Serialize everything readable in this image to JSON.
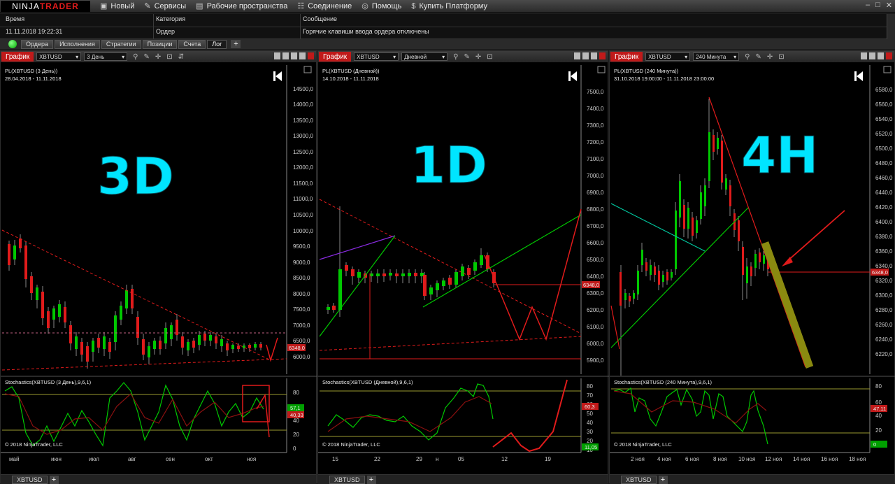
{
  "app": {
    "logo_left": "NINJA",
    "logo_right": "TRADER"
  },
  "menu": [
    {
      "icon": "new-icon",
      "label": "Новый"
    },
    {
      "icon": "services-icon",
      "label": "Сервисы"
    },
    {
      "icon": "workspace-icon",
      "label": "Рабочие пространства"
    },
    {
      "icon": "connection-icon",
      "label": "Соединение"
    },
    {
      "icon": "help-icon",
      "label": "Помощь"
    },
    {
      "icon": "dollar-icon",
      "label": "Купить Платформу"
    }
  ],
  "log": {
    "headers": [
      "Время",
      "Категория",
      "Сообщение"
    ],
    "row": [
      "11.11.2018 19:22:31",
      "Ордер",
      "Горячие клавиши ввода ордера отключены"
    ]
  },
  "tabs": [
    "Ордера",
    "Исполнения",
    "Стратегии",
    "Позиции",
    "Счета",
    "Лог"
  ],
  "active_tab": "Лог",
  "colors": {
    "accent": "#c01a1a",
    "cyan": "#00e5ff",
    "up": "#00c800",
    "down": "#e01b1b",
    "price_tag": "#c01a1a",
    "stoch_green": "#00c800"
  },
  "charts": [
    {
      "title": "График",
      "instrument": "XBTUSD",
      "timeframe": "3 День",
      "series_label": "PL(XBTUSD (3 День))",
      "range": "28.04.2018 - 11.11.2018",
      "big_label": "3D",
      "price_axis": [
        "14500,0",
        "14000,0",
        "13500,0",
        "13000,0",
        "12500,0",
        "12000,0",
        "11500,0",
        "11000,0",
        "10500,0",
        "10000,0",
        "9500,0",
        "9000,0",
        "8500,0",
        "8000,0",
        "7500,0",
        "7000,0",
        "6500,0",
        "6000,0"
      ],
      "price_tag": "6348,0",
      "stoch_label": "Stochastics(XBTUSD (3 День),9,6,1)",
      "stoch_axis": [
        "80",
        "60",
        "40",
        "20",
        "0"
      ],
      "stoch_tags": [
        "57,1",
        "40,33"
      ],
      "copyright": "© 2018 NinjaTrader, LLC",
      "time_axis": [
        "май",
        "июн",
        "июл",
        "авг",
        "сен",
        "окт",
        "ноя"
      ],
      "tag": "XBTUSD"
    },
    {
      "title": "График",
      "instrument": "XBTUSD",
      "timeframe": "Дневной",
      "series_label": "PL(XBTUSD (Дневной))",
      "range": "14.10.2018 - 11.11.2018",
      "big_label": "1D",
      "price_axis": [
        "7500,0",
        "7400,0",
        "7300,0",
        "7200,0",
        "7100,0",
        "7000,0",
        "6900,0",
        "6800,0",
        "6700,0",
        "6600,0",
        "6500,0",
        "6400,0",
        "6300,0",
        "6200,0",
        "6100,0",
        "6000,0",
        "5900,0"
      ],
      "price_tag": "6348,0",
      "stoch_label": "Stochastics(XBTUSD (Дневной),9,6,1)",
      "stoch_axis": [
        "80",
        "70",
        "60",
        "50",
        "40",
        "30",
        "20",
        "10"
      ],
      "stoch_tags": [
        "60,3",
        "11,05"
      ],
      "copyright": "© 2018 NinjaTrader, LLC",
      "time_axis": [
        "15",
        "22",
        "29",
        "н",
        "05",
        "12",
        "19"
      ],
      "tag": "XBTUSD"
    },
    {
      "title": "График",
      "instrument": "XBTUSD",
      "timeframe": "240 Минута",
      "series_label": "PL(XBTUSD (240 Минута))",
      "range": "31.10.2018 19:00:00 - 11.11.2018 23:00:00",
      "big_label": "4H",
      "price_axis": [
        "6580,0",
        "6560,0",
        "6540,0",
        "6520,0",
        "6500,0",
        "6480,0",
        "6460,0",
        "6440,0",
        "6420,0",
        "6400,0",
        "6380,0",
        "6360,0",
        "6340,0",
        "6320,0",
        "6300,0",
        "6280,0",
        "6260,0",
        "6240,0",
        "6220,0"
      ],
      "price_tag": "6348,0",
      "stoch_label": "Stochastics(XBTUSD (240 Минута),9,6,1)",
      "stoch_axis": [
        "80",
        "60",
        "40",
        "20",
        "0"
      ],
      "stoch_tags": [
        "47,11",
        "0"
      ],
      "copyright": "© 2018 NinjaTrader, LLC",
      "time_axis": [
        "2 ноя",
        "4 ноя",
        "6 ноя",
        "8 ноя",
        "10 ноя",
        "12 ноя",
        "14 ноя",
        "16 ноя",
        "18 ноя"
      ],
      "tag": "XBTUSD"
    }
  ]
}
